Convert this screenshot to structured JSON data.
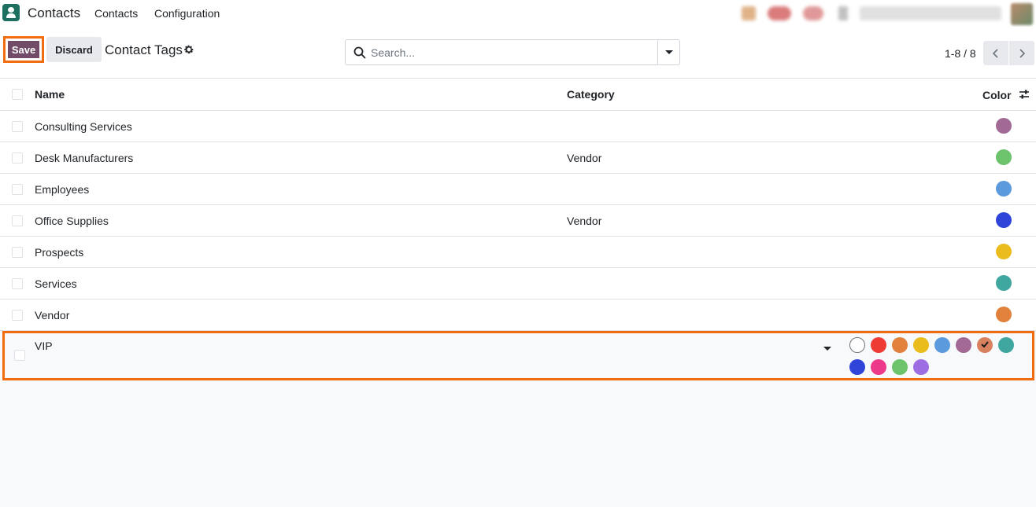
{
  "navbar": {
    "app_name": "Contacts",
    "menu": [
      "Contacts",
      "Configuration"
    ],
    "company": "My Company (San Francisco)"
  },
  "control_panel": {
    "save_label": "Save",
    "discard_label": "Discard",
    "title": "Contact Tags",
    "search_placeholder": "Search...",
    "pager": "1-8 / 8"
  },
  "table": {
    "columns": [
      "Name",
      "Category",
      "Color"
    ],
    "rows": [
      {
        "name": "Consulting Services",
        "category": "",
        "color": "#a16993"
      },
      {
        "name": "Desk Manufacturers",
        "category": "Vendor",
        "color": "#6cc36c"
      },
      {
        "name": "Employees",
        "category": "",
        "color": "#5b9bdd"
      },
      {
        "name": "Office Supplies",
        "category": "Vendor",
        "color": "#2f44d9"
      },
      {
        "name": "Prospects",
        "category": "",
        "color": "#eabc1c"
      },
      {
        "name": "Services",
        "category": "",
        "color": "#3fa79f"
      },
      {
        "name": "Vendor",
        "category": "",
        "color": "#e1813b"
      }
    ],
    "editing_row": {
      "name": "VIP",
      "selected_color_index": 6,
      "palette": [
        "#ffffff",
        "#ee3b34",
        "#e1813b",
        "#eabc1c",
        "#5b9bdd",
        "#a16993",
        "#d9805f",
        "#3fa79f",
        "#2f44d9",
        "#ec3989",
        "#6cc36c",
        "#9d6ee3"
      ]
    }
  }
}
